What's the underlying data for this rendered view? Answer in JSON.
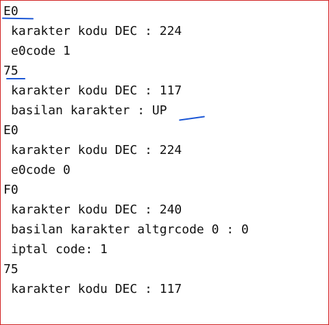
{
  "log": {
    "lines": [
      {
        "text": "E0",
        "indent": false
      },
      {
        "text": "karakter kodu DEC : 224",
        "indent": true
      },
      {
        "text": "e0code 1",
        "indent": true
      },
      {
        "text": "75",
        "indent": false
      },
      {
        "text": "karakter kodu DEC : 117",
        "indent": true
      },
      {
        "text": "basilan karakter : UP",
        "indent": true
      },
      {
        "text": "E0",
        "indent": false
      },
      {
        "text": "karakter kodu DEC : 224",
        "indent": true
      },
      {
        "text": "e0code 0",
        "indent": true
      },
      {
        "text": "F0",
        "indent": false
      },
      {
        "text": "karakter kodu DEC : 240",
        "indent": true
      },
      {
        "text": "basilan karakter altgrcode 0 : 0",
        "indent": true
      },
      {
        "text": "iptal code: 1",
        "indent": true
      },
      {
        "text": "75",
        "indent": false
      },
      {
        "text": "karakter kodu DEC : 117",
        "indent": true
      }
    ]
  },
  "colors": {
    "border": "#d02020",
    "annotation": "#1a56d6",
    "text": "#111111",
    "background": "#ffffff"
  }
}
